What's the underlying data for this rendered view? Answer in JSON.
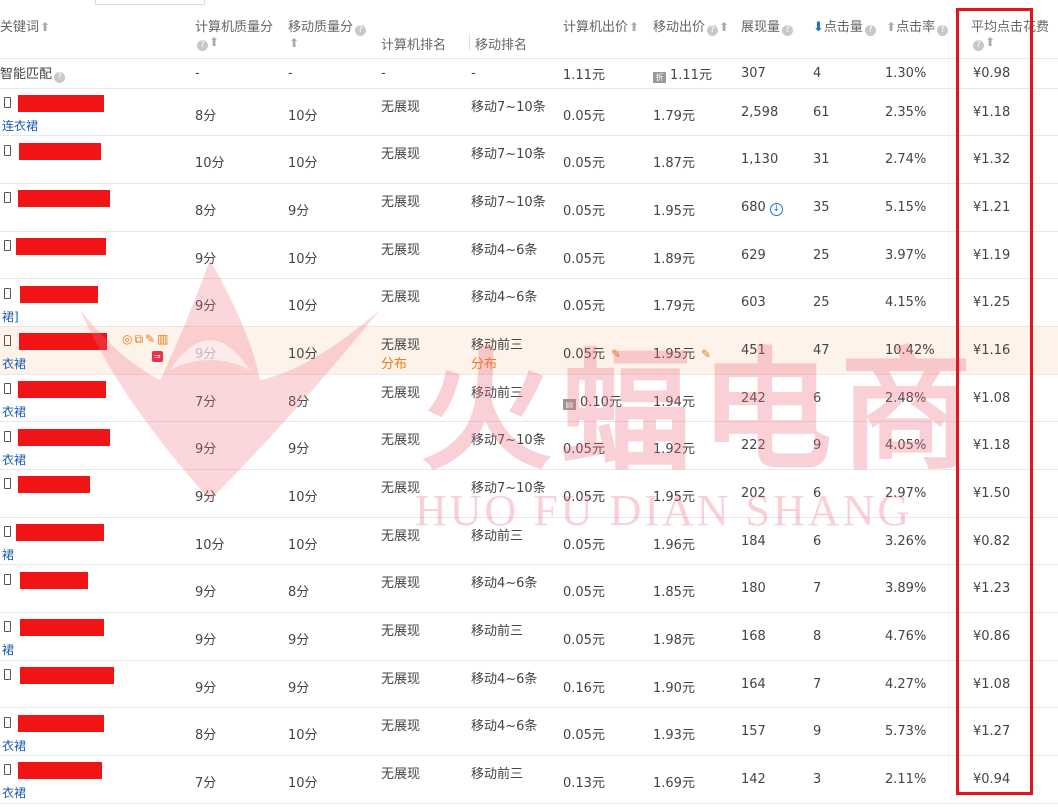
{
  "headers": {
    "keyword": "关键词",
    "pc_quality": "计算机质量分",
    "mobile_quality": "移动质量分",
    "pc_rank": "计算机排名",
    "mobile_rank": "移动排名",
    "pc_bid": "计算机出价",
    "mobile_bid": "移动出价",
    "impressions": "展现量",
    "clicks": "点击量",
    "ctr": "点击率",
    "avg_cpc": "平均点击花费"
  },
  "smart_match": {
    "label": "智能匹配",
    "pc_quality": "-",
    "mobile_quality": "-",
    "pc_rank": "-",
    "mobile_rank": "-",
    "pc_bid": "1.11元",
    "mobile_bid": "1.11元",
    "impressions": "307",
    "clicks": "4",
    "ctr": "1.30%",
    "avg_cpc": "¥0.98"
  },
  "rows": [
    {
      "sub": "连衣裙",
      "pcq": "8分",
      "mq": "10分",
      "pcr": "无展现",
      "mr": "移动7~10条",
      "pcb": "0.05元",
      "mb": "1.79元",
      "imp": "2,598",
      "clk": "61",
      "ctr": "2.35%",
      "cpc": "¥1.18"
    },
    {
      "sub": "",
      "pcq": "10分",
      "mq": "10分",
      "pcr": "无展现",
      "mr": "移动7~10条",
      "pcb": "0.05元",
      "mb": "1.87元",
      "imp": "1,130",
      "clk": "31",
      "ctr": "2.74%",
      "cpc": "¥1.32"
    },
    {
      "sub": "",
      "pcq": "8分",
      "mq": "9分",
      "pcr": "无展现",
      "mr": "移动7~10条",
      "pcb": "0.05元",
      "mb": "1.95元",
      "imp": "680",
      "clk": "35",
      "ctr": "5.15%",
      "cpc": "¥1.21"
    },
    {
      "sub": "",
      "pcq": "9分",
      "mq": "10分",
      "pcr": "无展现",
      "mr": "移动4~6条",
      "pcb": "0.05元",
      "mb": "1.89元",
      "imp": "629",
      "clk": "25",
      "ctr": "3.97%",
      "cpc": "¥1.19"
    },
    {
      "sub": "裙]",
      "pcq": "9分",
      "mq": "10分",
      "pcr": "无展现",
      "mr": "移动4~6条",
      "pcb": "0.05元",
      "mb": "1.79元",
      "imp": "603",
      "clk": "25",
      "ctr": "4.15%",
      "cpc": "¥1.25"
    },
    {
      "sub": "衣裙",
      "pcq": "9分",
      "mq": "10分",
      "pcr": "无展现",
      "mr": "移动前三",
      "pcb": "0.05元",
      "mb": "1.95元",
      "imp": "451",
      "clk": "47",
      "ctr": "10.42%",
      "cpc": "¥1.16",
      "extra": "分布"
    },
    {
      "sub": "衣裙",
      "pcq": "7分",
      "mq": "8分",
      "pcr": "无展现",
      "mr": "移动前三",
      "pcb": "0.10元",
      "mb": "1.94元",
      "imp": "242",
      "clk": "6",
      "ctr": "2.48%",
      "cpc": "¥1.08"
    },
    {
      "sub": "衣裙",
      "pcq": "9分",
      "mq": "9分",
      "pcr": "无展现",
      "mr": "移动7~10条",
      "pcb": "0.05元",
      "mb": "1.92元",
      "imp": "222",
      "clk": "9",
      "ctr": "4.05%",
      "cpc": "¥1.18"
    },
    {
      "sub": "",
      "pcq": "9分",
      "mq": "10分",
      "pcr": "无展现",
      "mr": "移动7~10条",
      "pcb": "0.05元",
      "mb": "1.95元",
      "imp": "202",
      "clk": "6",
      "ctr": "2.97%",
      "cpc": "¥1.50"
    },
    {
      "sub": "裙",
      "pcq": "10分",
      "mq": "10分",
      "pcr": "无展现",
      "mr": "移动前三",
      "pcb": "0.05元",
      "mb": "1.96元",
      "imp": "184",
      "clk": "6",
      "ctr": "3.26%",
      "cpc": "¥0.82"
    },
    {
      "sub": "",
      "pcq": "9分",
      "mq": "8分",
      "pcr": "无展现",
      "mr": "移动4~6条",
      "pcb": "0.05元",
      "mb": "1.85元",
      "imp": "180",
      "clk": "7",
      "ctr": "3.89%",
      "cpc": "¥1.23"
    },
    {
      "sub": "裙",
      "pcq": "9分",
      "mq": "9分",
      "pcr": "无展现",
      "mr": "移动前三",
      "pcb": "0.05元",
      "mb": "1.98元",
      "imp": "168",
      "clk": "8",
      "ctr": "4.76%",
      "cpc": "¥0.86"
    },
    {
      "sub": "",
      "pcq": "9分",
      "mq": "9分",
      "pcr": "无展现",
      "mr": "移动4~6条",
      "pcb": "0.16元",
      "mb": "1.90元",
      "imp": "164",
      "clk": "7",
      "ctr": "4.27%",
      "cpc": "¥1.08"
    },
    {
      "sub": "衣裙",
      "pcq": "8分",
      "mq": "10分",
      "pcr": "无展现",
      "mr": "移动4~6条",
      "pcb": "0.05元",
      "mb": "1.93元",
      "imp": "157",
      "clk": "9",
      "ctr": "5.73%",
      "cpc": "¥1.27"
    },
    {
      "sub": "衣裙",
      "pcq": "7分",
      "mq": "10分",
      "pcr": "无展现",
      "mr": "移动前三",
      "pcb": "0.13元",
      "mb": "1.69元",
      "imp": "142",
      "clk": "3",
      "ctr": "2.11%",
      "cpc": "¥0.94"
    }
  ],
  "watermark": {
    "title": "火蝠电商",
    "subtitle": "HUO FU DIAN SHANG"
  },
  "colors": {
    "redaction": "#f01414",
    "highlight_box": "#e0161e",
    "link": "#1a5cb0",
    "accent_orange": "#f07a14",
    "highlighted_row": "#fdf3ea"
  }
}
